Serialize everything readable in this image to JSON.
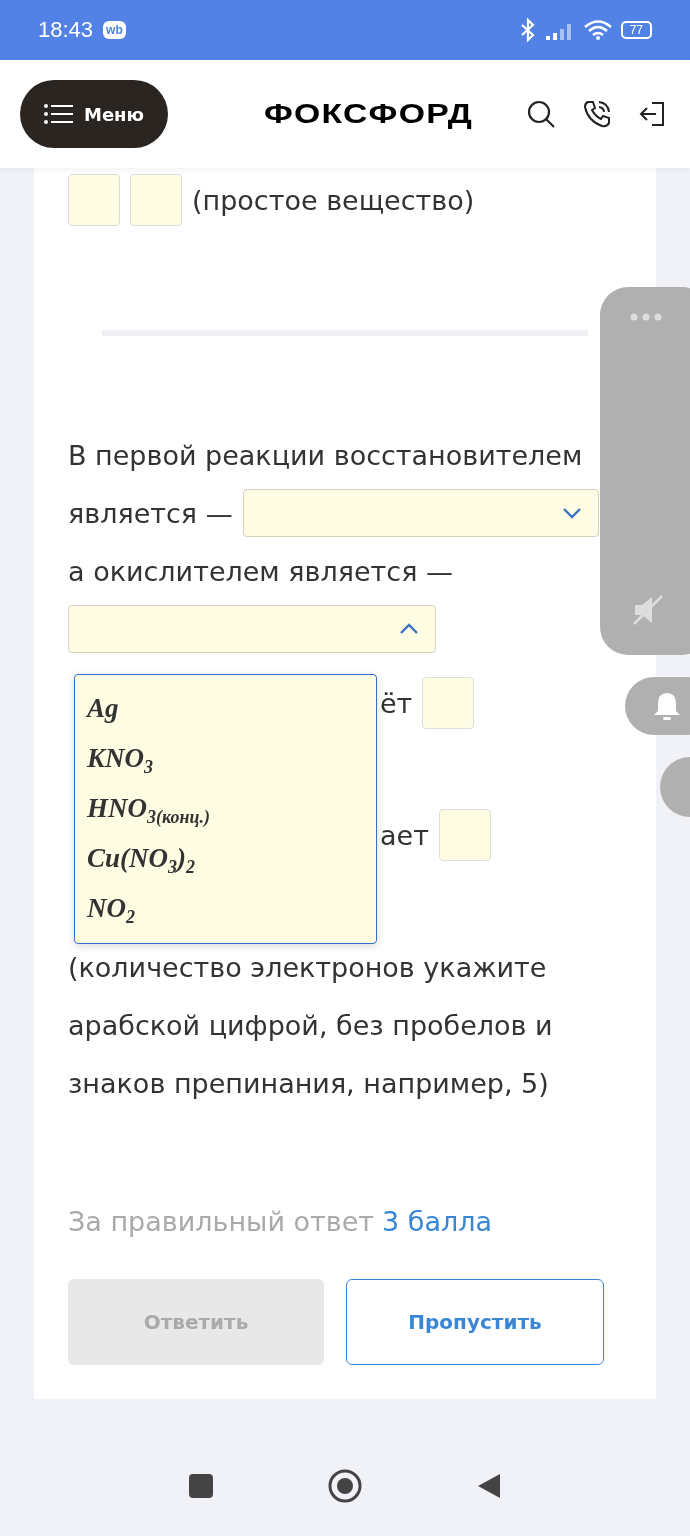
{
  "status_bar": {
    "time": "18:43",
    "app_badge": "wb",
    "battery": "77"
  },
  "header": {
    "menu_label": "Меню",
    "logo": "ФОКСФОРД"
  },
  "answer_row": {
    "caption": "(простое вещество)"
  },
  "question": {
    "line_1": "В первой реакции восстановителем",
    "line_2": "является —",
    "line_3": "а окислителем является —",
    "selects": [
      {
        "expanded": false
      },
      {
        "expanded": true,
        "options": [
          {
            "text": "Ag"
          },
          {
            "text": "KNO$_{3}$"
          },
          {
            "text": "HNO$_{3(конц.)}$"
          },
          {
            "text": "Cu(NO$_{3}$)$_{2}$"
          },
          {
            "text": "NO$_{2}$"
          }
        ]
      }
    ],
    "partial_line_1": "ёт",
    "partial_line_2": "ает",
    "note_lines": [
      "(количество электронов укажите",
      "арабской цифрой, без пробелов и",
      "знаков препинания, например, 5)"
    ]
  },
  "score": {
    "label": "За правильный ответ",
    "points": "3 балла"
  },
  "buttons": [
    {
      "label": "Ответить",
      "disabled": true
    },
    {
      "label": "Пропустить",
      "disabled": false
    }
  ]
}
